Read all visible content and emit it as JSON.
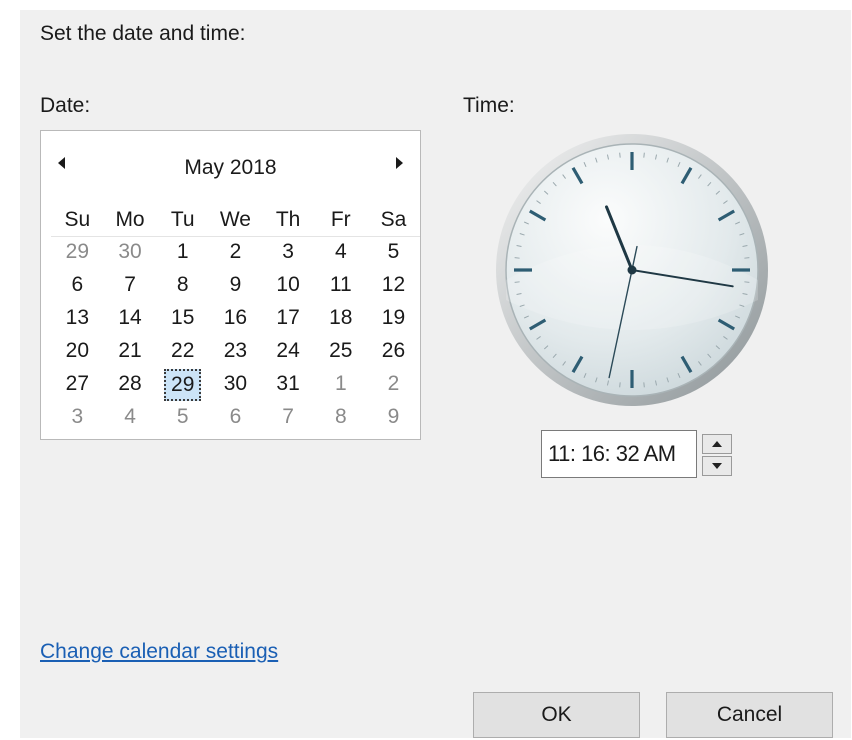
{
  "dialog": {
    "heading": "Set the date and time:",
    "date_label": "Date:",
    "time_label": "Time:",
    "change_calendar_link": "Change calendar settings",
    "ok_label": "OK",
    "cancel_label": "Cancel"
  },
  "calendar": {
    "month_title": "May 2018",
    "prev_icon": "left-triangle-icon",
    "next_icon": "right-triangle-icon",
    "weekdays": [
      "Su",
      "Mo",
      "Tu",
      "We",
      "Th",
      "Fr",
      "Sa"
    ],
    "weeks": [
      [
        {
          "d": "29",
          "other": true
        },
        {
          "d": "30",
          "other": true
        },
        {
          "d": "1"
        },
        {
          "d": "2"
        },
        {
          "d": "3"
        },
        {
          "d": "4"
        },
        {
          "d": "5"
        }
      ],
      [
        {
          "d": "6"
        },
        {
          "d": "7"
        },
        {
          "d": "8"
        },
        {
          "d": "9"
        },
        {
          "d": "10"
        },
        {
          "d": "11"
        },
        {
          "d": "12"
        }
      ],
      [
        {
          "d": "13"
        },
        {
          "d": "14"
        },
        {
          "d": "15"
        },
        {
          "d": "16"
        },
        {
          "d": "17"
        },
        {
          "d": "18"
        },
        {
          "d": "19"
        }
      ],
      [
        {
          "d": "20"
        },
        {
          "d": "21"
        },
        {
          "d": "22"
        },
        {
          "d": "23"
        },
        {
          "d": "24"
        },
        {
          "d": "25"
        },
        {
          "d": "26"
        }
      ],
      [
        {
          "d": "27"
        },
        {
          "d": "28"
        },
        {
          "d": "29",
          "selected": true
        },
        {
          "d": "30"
        },
        {
          "d": "31"
        },
        {
          "d": "1",
          "other": true
        },
        {
          "d": "2",
          "other": true
        }
      ],
      [
        {
          "d": "3",
          "other": true
        },
        {
          "d": "4",
          "other": true
        },
        {
          "d": "5",
          "other": true
        },
        {
          "d": "6",
          "other": true
        },
        {
          "d": "7",
          "other": true
        },
        {
          "d": "8",
          "other": true
        },
        {
          "d": "9",
          "other": true
        }
      ]
    ]
  },
  "time": {
    "value": "11: 16: 32 AM",
    "hour": 11,
    "minute": 16,
    "second": 32
  },
  "colors": {
    "dialog_bg": "#f0f0f0",
    "link": "#1a5fb4",
    "selected_day": "#cce4f7",
    "clock_tick": "#2e5d73"
  }
}
